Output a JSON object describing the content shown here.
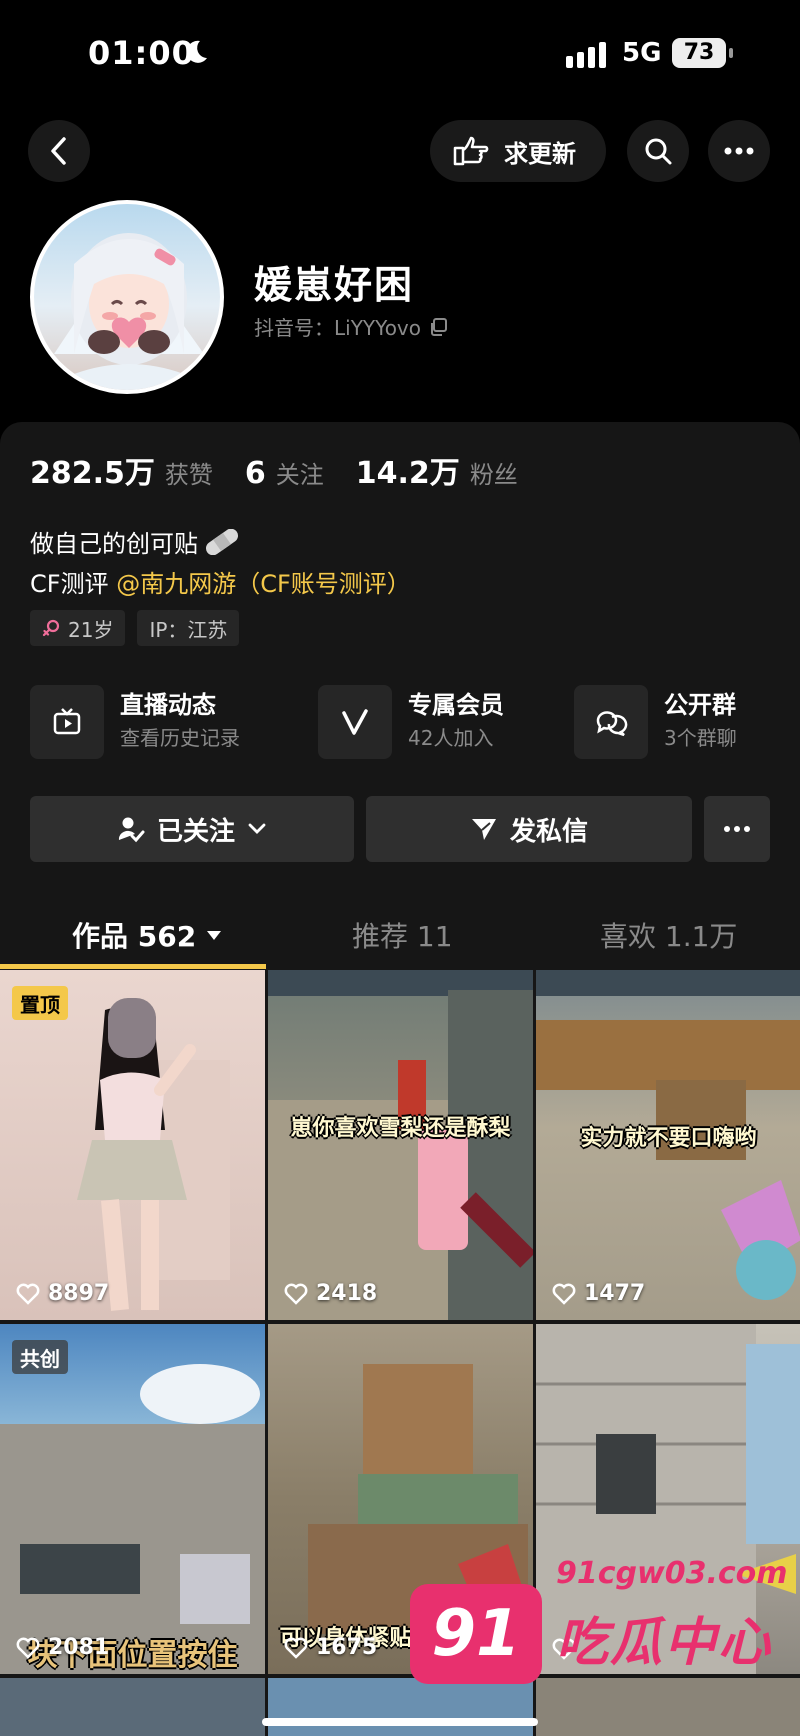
{
  "status_bar": {
    "time": "01:00",
    "network": "5G",
    "battery": "73"
  },
  "nav": {
    "request_update_label": "求更新"
  },
  "profile": {
    "username": "媛崽好困",
    "douyin_id_label": "抖音号：LiYYYovo",
    "stats": [
      {
        "value": "282.5万",
        "label": "获赞"
      },
      {
        "value": "6",
        "label": "关注"
      },
      {
        "value": "14.2万",
        "label": "粉丝"
      }
    ],
    "bio_line1": "做自己的创可贴",
    "bio_line2_prefix": "CF测评 ",
    "bio_line2_mention": "@南九网游（CF账号测评）",
    "tags": {
      "age": "21岁",
      "ip": "IP：江苏"
    }
  },
  "features": [
    {
      "title": "直播动态",
      "subtitle": "查看历史记录",
      "icon": "tv-icon"
    },
    {
      "title": "专属会员",
      "subtitle": "42人加入",
      "icon": "v-icon"
    },
    {
      "title": "公开群",
      "subtitle": "3个群聊",
      "icon": "chat-bubbles-icon"
    }
  ],
  "actions": {
    "following_label": "已关注",
    "message_label": "发私信"
  },
  "tabs": [
    {
      "label": "作品 562",
      "active": true
    },
    {
      "label": "推荐 11",
      "active": false
    },
    {
      "label": "喜欢 1.1万",
      "active": false
    }
  ],
  "videos": [
    {
      "likes": "8897",
      "badge": "置顶",
      "caption": ""
    },
    {
      "likes": "2418",
      "badge": "",
      "caption": "崽你喜欢雪梨还是酥梨"
    },
    {
      "likes": "1477",
      "badge": "",
      "caption": "实力就不要口嗨哟"
    },
    {
      "likes": "2081",
      "badge": "共创",
      "caption": "块下面位置按住"
    },
    {
      "likes": "1675",
      "badge": "",
      "caption": "可以身体紧贴来到对面介"
    },
    {
      "likes": "",
      "badge": "",
      "caption": ""
    }
  ],
  "watermark": {
    "logo": "91",
    "url": "91cgw03.com",
    "text": "吃瓜中心"
  },
  "colors": {
    "accent": "#f4c84a",
    "background": "#000000",
    "panel": "#161616",
    "watermark": "#e8306e"
  }
}
